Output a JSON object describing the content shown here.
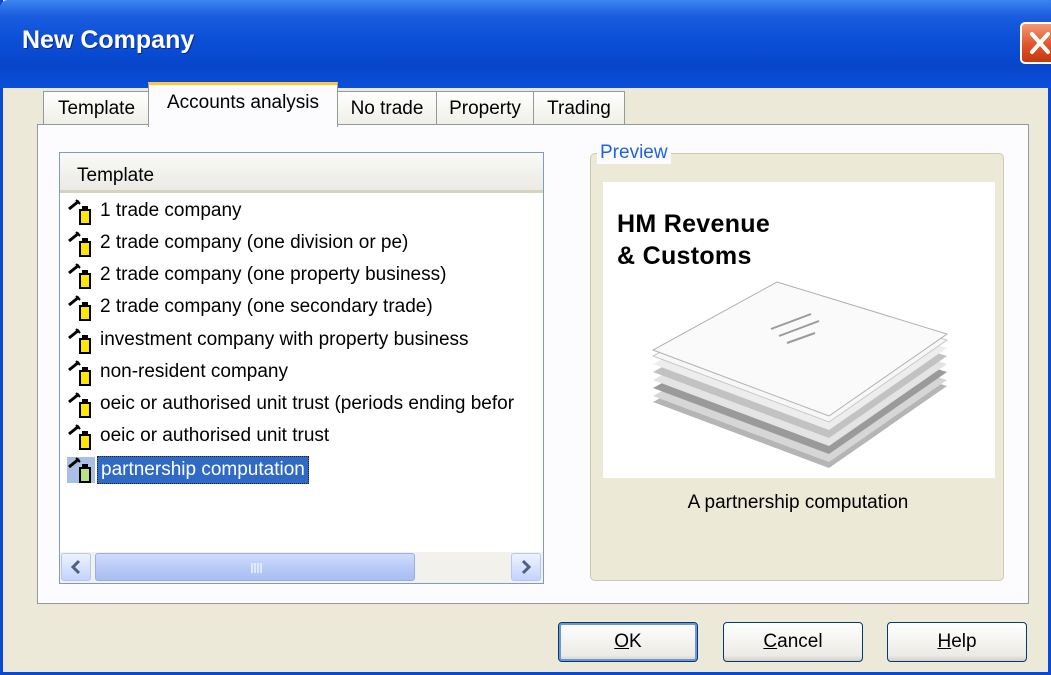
{
  "window": {
    "title": "New Company"
  },
  "tabs": [
    {
      "label": "Template",
      "active": false
    },
    {
      "label": "Accounts analysis",
      "active": true
    },
    {
      "label": "No trade",
      "active": false
    },
    {
      "label": "Property",
      "active": false
    },
    {
      "label": "Trading",
      "active": false
    }
  ],
  "list": {
    "column_header": "Template",
    "selected_index": 8,
    "items": [
      "1 trade company",
      "2 trade company (one division or pe)",
      "2 trade company (one property business)",
      "2 trade company (one secondary trade)",
      "investment company with property business",
      "non-resident company",
      "oeic or authorised unit trust (periods ending befor",
      "oeic or authorised unit trust",
      "partnership computation"
    ],
    "item_icon": "template-wand-icon",
    "scroll_position": 0.0
  },
  "preview": {
    "legend": "Preview",
    "image_line1": "HM Revenue",
    "image_line2": "& Customs",
    "caption": "A partnership computation"
  },
  "buttons": {
    "ok_access": "O",
    "ok_rest": "K",
    "cancel_access": "C",
    "cancel_rest": "ancel",
    "help_access": "H",
    "help_rest": "elp"
  },
  "colors": {
    "title_bar": "#0a4fd8",
    "selection": "#316ac5",
    "active_tab_accent": "#ffc83c",
    "close_button": "#e0542a"
  }
}
